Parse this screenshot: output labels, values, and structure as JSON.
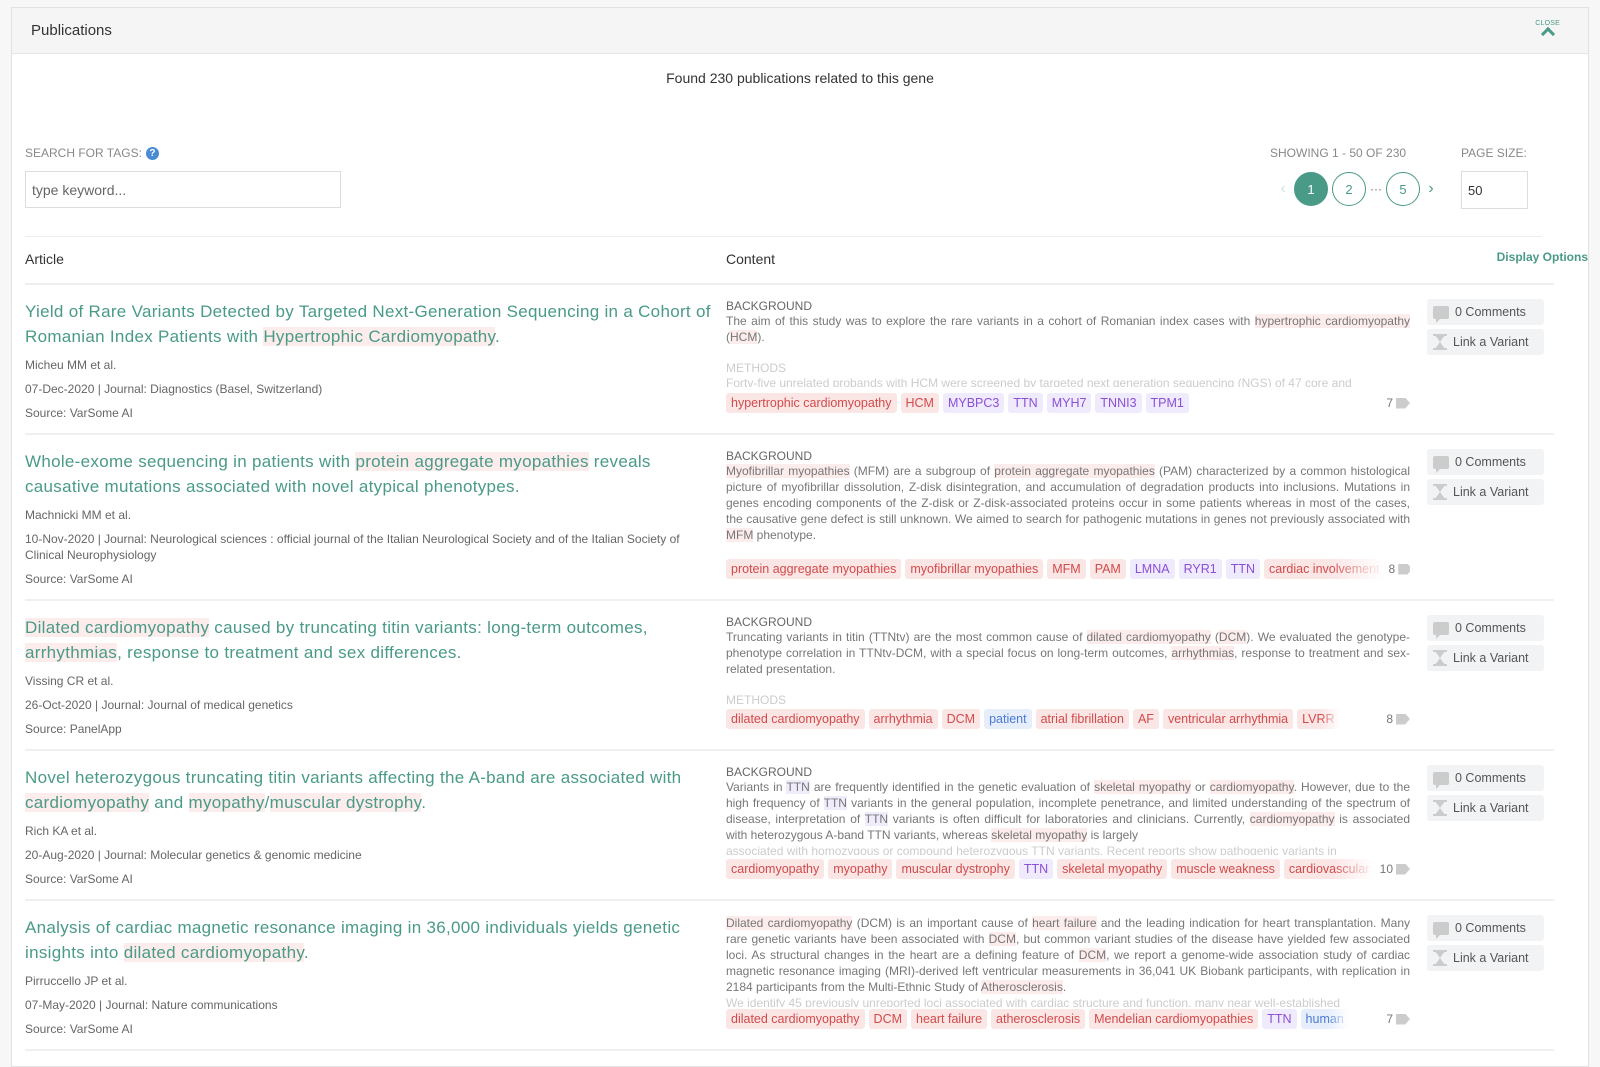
{
  "header": {
    "title": "Publications",
    "close_label": "CLOSE"
  },
  "found_text": "Found 230 publications related to this gene",
  "search": {
    "label": "SEARCH FOR TAGS:",
    "placeholder": "type keyword..."
  },
  "pagination": {
    "showing": "SHOWING 1 - 50 OF 230",
    "pages": [
      "1",
      "2",
      "5"
    ],
    "current_page": "1",
    "ellipsis": "···",
    "prev": "‹",
    "next": "›",
    "page_size_label": "PAGE SIZE:",
    "page_size": "50"
  },
  "table": {
    "col_article": "Article",
    "col_content": "Content",
    "display_options": "Display Options"
  },
  "actions": {
    "comments": "0 Comments",
    "link_variant": "Link a Variant"
  },
  "colors": {
    "accent": "#4a9a88",
    "tag_red_bg": "#fbe6e6",
    "tag_red_fg": "#d24a4a",
    "tag_purple_bg": "#f0eafd",
    "tag_purple_fg": "#8a50d6",
    "tag_blue_bg": "#e6eefc",
    "tag_blue_fg": "#4a7ad6"
  },
  "publications": [
    {
      "title_parts": [
        [
          "Yield of Rare Variants Detected by Targeted Next-Generation Sequencing in a Cohort of Romanian Index Patients with ",
          ""
        ],
        [
          "Hypertrophic Cardiomyopathy",
          "r"
        ],
        [
          ".",
          ""
        ]
      ],
      "authors": "Micheu MM et al.",
      "date_journal": "07-Dec-2020 | Journal: Diagnostics (Basel, Switzerland)",
      "source": "Source: VarSome AI",
      "sections": [
        {
          "label": "BACKGROUND",
          "parts": [
            [
              "The aim of this study was to explore the rare variants in a cohort of Romanian index cases with ",
              ""
            ],
            [
              "hypertrophic cardiomyopathy",
              "r"
            ],
            [
              " (",
              ""
            ],
            [
              "HCM",
              "r"
            ],
            [
              ").",
              ""
            ]
          ]
        },
        {
          "label": "METHODS",
          "faded_text": "Forty-five unrelated probands with HCM were screened by targeted next generation sequencing (NGS) of 47 core and"
        }
      ],
      "tags": [
        [
          "hypertrophic cardiomyopathy",
          "r"
        ],
        [
          "HCM",
          "r"
        ],
        [
          "MYBPC3",
          "g"
        ],
        [
          "TTN",
          "g"
        ],
        [
          "MYH7",
          "g"
        ],
        [
          "TNNI3",
          "g"
        ],
        [
          "TPM1",
          "g"
        ]
      ],
      "tag_count": "7"
    },
    {
      "title_parts": [
        [
          "Whole-exome sequencing in patients with ",
          ""
        ],
        [
          "protein aggregate myopathies",
          "r"
        ],
        [
          " reveals causative mutations associated with novel atypical phenotypes.",
          ""
        ]
      ],
      "authors": "Machnicki MM et al.",
      "date_journal": "10-Nov-2020 | Journal: Neurological sciences : official journal of the Italian Neurological Society and of the Italian Society of Clinical Neurophysiology",
      "source": "Source: VarSome AI",
      "sections": [
        {
          "label": "BACKGROUND",
          "parts": [
            [
              "Myofibrillar myopathies",
              "r"
            ],
            [
              " (MFM) are a subgroup of ",
              ""
            ],
            [
              "protein aggregate myopathies",
              "r"
            ],
            [
              " (PAM) characterized by a common histological picture of myofibrillar dissolution, Z-disk disintegration, and accumulation of degradation products into inclusions. Mutations in genes encoding components of the Z-disk or Z-disk-associated proteins occur in some patients whereas in most of the cases, the causative gene defect is still unknown. We aimed to search for pathogenic mutations in genes not previously associated with ",
              ""
            ],
            [
              "MFM",
              "r"
            ],
            [
              " phenotype.",
              ""
            ]
          ]
        }
      ],
      "tags": [
        [
          "protein aggregate myopathies",
          "r"
        ],
        [
          "myofibrillar myopathies",
          "r"
        ],
        [
          "MFM",
          "r"
        ],
        [
          "PAM",
          "r"
        ],
        [
          "LMNA",
          "g"
        ],
        [
          "RYR1",
          "g"
        ],
        [
          "TTN",
          "g"
        ],
        [
          "cardiac involvement",
          "r"
        ]
      ],
      "tag_count": "8"
    },
    {
      "title_parts": [
        [
          "Dilated cardiomyopathy",
          "r"
        ],
        [
          " caused by truncating titin variants: long-term outcomes, ",
          ""
        ],
        [
          "arrhythmias",
          "r"
        ],
        [
          ", response to treatment and sex differences.",
          ""
        ]
      ],
      "authors": "Vissing CR et al.",
      "date_journal": "26-Oct-2020 | Journal: Journal of medical genetics",
      "source": "Source: PanelApp",
      "sections": [
        {
          "label": "BACKGROUND",
          "parts": [
            [
              "Truncating variants in titin (TTNtv) are the most common cause of ",
              ""
            ],
            [
              "dilated cardiomyopathy",
              "r"
            ],
            [
              " (",
              ""
            ],
            [
              "DCM",
              "r"
            ],
            [
              "). We evaluated the genotype-phenotype correlation in TTNtv-DCM, with a special focus on long-term outcomes, ",
              ""
            ],
            [
              "arrhythmias",
              "r"
            ],
            [
              ", response to treatment and sex-related presentation.",
              ""
            ]
          ]
        },
        {
          "label": "METHODS",
          "faded_text": ""
        }
      ],
      "tags": [
        [
          "dilated cardiomyopathy",
          "r"
        ],
        [
          "arrhythmia",
          "r"
        ],
        [
          "DCM",
          "r"
        ],
        [
          "patient",
          "b"
        ],
        [
          "atrial fibrillation",
          "r"
        ],
        [
          "AF",
          "r"
        ],
        [
          "ventricular arrhythmia",
          "r"
        ],
        [
          "LVRR",
          "r"
        ]
      ],
      "tag_count": "8"
    },
    {
      "title_parts": [
        [
          "Novel heterozygous truncating titin variants affecting the A-band are associated with ",
          ""
        ],
        [
          "cardiomyopathy",
          "r"
        ],
        [
          " and ",
          ""
        ],
        [
          "myopathy",
          "r"
        ],
        [
          "/",
          ""
        ],
        [
          "muscular dystrophy",
          "r"
        ],
        [
          ".",
          ""
        ]
      ],
      "authors": "Rich KA et al.",
      "date_journal": "20-Aug-2020 | Journal: Molecular genetics & genomic medicine",
      "source": "Source: VarSome AI",
      "sections": [
        {
          "label": "BACKGROUND",
          "parts": [
            [
              "Variants in ",
              ""
            ],
            [
              "TTN",
              "g"
            ],
            [
              " are frequently identified in the genetic evaluation of ",
              ""
            ],
            [
              "skeletal myopathy",
              "r"
            ],
            [
              " or ",
              ""
            ],
            [
              "cardiomyopathy",
              "r"
            ],
            [
              ". However, due to the high frequency of ",
              ""
            ],
            [
              "TTN",
              "g"
            ],
            [
              " variants in the general population, incomplete penetrance, and limited understanding of the spectrum of disease, interpretation of ",
              ""
            ],
            [
              "TTN",
              "g"
            ],
            [
              " variants is often difficult for laboratories and clinicians. Currently, ",
              ""
            ],
            [
              "cardiomyopathy",
              "r"
            ],
            [
              " is associated with heterozygous A-band TTN variants, whereas ",
              ""
            ],
            [
              "skeletal myopathy",
              "r"
            ],
            [
              " is largely",
              ""
            ]
          ],
          "faded_text": "associated with homozygous or compound heterozygous TTN variants. Recent reports show pathogenic variants in"
        }
      ],
      "tags": [
        [
          "cardiomyopathy",
          "r"
        ],
        [
          "myopathy",
          "r"
        ],
        [
          "muscular dystrophy",
          "r"
        ],
        [
          "TTN",
          "g"
        ],
        [
          "skeletal myopathy",
          "r"
        ],
        [
          "muscle weakness",
          "r"
        ],
        [
          "cardiovascular",
          "r"
        ]
      ],
      "tag_count": "10"
    },
    {
      "title_parts": [
        [
          "Analysis of cardiac magnetic resonance imaging in 36,000 individuals yields genetic insights into ",
          ""
        ],
        [
          "dilated cardiomyopathy",
          "r"
        ],
        [
          ".",
          ""
        ]
      ],
      "authors": "Pirruccello JP et al.",
      "date_journal": "07-May-2020 | Journal: Nature communications",
      "source": "Source: VarSome AI",
      "sections": [
        {
          "label": "",
          "parts": [
            [
              "Dilated cardiomyopathy",
              "r"
            ],
            [
              " (DCM) is an important cause of ",
              ""
            ],
            [
              "heart failure",
              "r"
            ],
            [
              " and the leading indication for heart transplantation. Many rare genetic variants have been associated with ",
              ""
            ],
            [
              "DCM",
              "r"
            ],
            [
              ", but common variant studies of the disease have yielded few associated loci. As structural changes in the heart are a defining feature of ",
              ""
            ],
            [
              "DCM",
              "r"
            ],
            [
              ", we report a genome-wide association study of cardiac magnetic resonance imaging (MRI)-derived left ventricular measurements in 36,041 UK Biobank participants, with replication in 2184 participants from the Multi-Ethnic Study of ",
              ""
            ],
            [
              "Atherosclerosis",
              "r"
            ],
            [
              ".",
              ""
            ]
          ],
          "faded_text": "We identify 45 previously unreported loci associated with cardiac structure and function, many near well-established"
        }
      ],
      "tags": [
        [
          "dilated cardiomyopathy",
          "r"
        ],
        [
          "DCM",
          "r"
        ],
        [
          "heart failure",
          "r"
        ],
        [
          "atherosclerosis",
          "r"
        ],
        [
          "Mendelian cardiomyopathies",
          "r"
        ],
        [
          "TTN",
          "g"
        ],
        [
          "human",
          "b"
        ]
      ],
      "tag_count": "7"
    }
  ]
}
